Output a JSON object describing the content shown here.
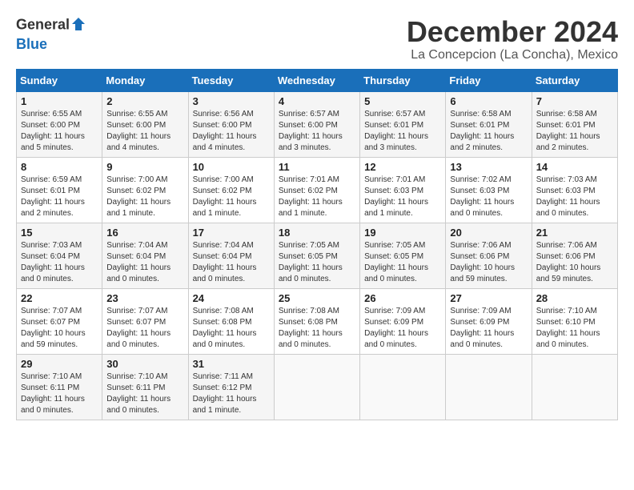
{
  "logo": {
    "general": "General",
    "blue": "Blue"
  },
  "header": {
    "month": "December 2024",
    "location": "La Concepcion (La Concha), Mexico"
  },
  "weekdays": [
    "Sunday",
    "Monday",
    "Tuesday",
    "Wednesday",
    "Thursday",
    "Friday",
    "Saturday"
  ],
  "weeks": [
    [
      {
        "day": "1",
        "info": "Sunrise: 6:55 AM\nSunset: 6:00 PM\nDaylight: 11 hours and 5 minutes."
      },
      {
        "day": "2",
        "info": "Sunrise: 6:55 AM\nSunset: 6:00 PM\nDaylight: 11 hours and 4 minutes."
      },
      {
        "day": "3",
        "info": "Sunrise: 6:56 AM\nSunset: 6:00 PM\nDaylight: 11 hours and 4 minutes."
      },
      {
        "day": "4",
        "info": "Sunrise: 6:57 AM\nSunset: 6:00 PM\nDaylight: 11 hours and 3 minutes."
      },
      {
        "day": "5",
        "info": "Sunrise: 6:57 AM\nSunset: 6:01 PM\nDaylight: 11 hours and 3 minutes."
      },
      {
        "day": "6",
        "info": "Sunrise: 6:58 AM\nSunset: 6:01 PM\nDaylight: 11 hours and 2 minutes."
      },
      {
        "day": "7",
        "info": "Sunrise: 6:58 AM\nSunset: 6:01 PM\nDaylight: 11 hours and 2 minutes."
      }
    ],
    [
      {
        "day": "8",
        "info": "Sunrise: 6:59 AM\nSunset: 6:01 PM\nDaylight: 11 hours and 2 minutes."
      },
      {
        "day": "9",
        "info": "Sunrise: 7:00 AM\nSunset: 6:02 PM\nDaylight: 11 hours and 1 minute."
      },
      {
        "day": "10",
        "info": "Sunrise: 7:00 AM\nSunset: 6:02 PM\nDaylight: 11 hours and 1 minute."
      },
      {
        "day": "11",
        "info": "Sunrise: 7:01 AM\nSunset: 6:02 PM\nDaylight: 11 hours and 1 minute."
      },
      {
        "day": "12",
        "info": "Sunrise: 7:01 AM\nSunset: 6:03 PM\nDaylight: 11 hours and 1 minute."
      },
      {
        "day": "13",
        "info": "Sunrise: 7:02 AM\nSunset: 6:03 PM\nDaylight: 11 hours and 0 minutes."
      },
      {
        "day": "14",
        "info": "Sunrise: 7:03 AM\nSunset: 6:03 PM\nDaylight: 11 hours and 0 minutes."
      }
    ],
    [
      {
        "day": "15",
        "info": "Sunrise: 7:03 AM\nSunset: 6:04 PM\nDaylight: 11 hours and 0 minutes."
      },
      {
        "day": "16",
        "info": "Sunrise: 7:04 AM\nSunset: 6:04 PM\nDaylight: 11 hours and 0 minutes."
      },
      {
        "day": "17",
        "info": "Sunrise: 7:04 AM\nSunset: 6:04 PM\nDaylight: 11 hours and 0 minutes."
      },
      {
        "day": "18",
        "info": "Sunrise: 7:05 AM\nSunset: 6:05 PM\nDaylight: 11 hours and 0 minutes."
      },
      {
        "day": "19",
        "info": "Sunrise: 7:05 AM\nSunset: 6:05 PM\nDaylight: 11 hours and 0 minutes."
      },
      {
        "day": "20",
        "info": "Sunrise: 7:06 AM\nSunset: 6:06 PM\nDaylight: 10 hours and 59 minutes."
      },
      {
        "day": "21",
        "info": "Sunrise: 7:06 AM\nSunset: 6:06 PM\nDaylight: 10 hours and 59 minutes."
      }
    ],
    [
      {
        "day": "22",
        "info": "Sunrise: 7:07 AM\nSunset: 6:07 PM\nDaylight: 10 hours and 59 minutes."
      },
      {
        "day": "23",
        "info": "Sunrise: 7:07 AM\nSunset: 6:07 PM\nDaylight: 11 hours and 0 minutes."
      },
      {
        "day": "24",
        "info": "Sunrise: 7:08 AM\nSunset: 6:08 PM\nDaylight: 11 hours and 0 minutes."
      },
      {
        "day": "25",
        "info": "Sunrise: 7:08 AM\nSunset: 6:08 PM\nDaylight: 11 hours and 0 minutes."
      },
      {
        "day": "26",
        "info": "Sunrise: 7:09 AM\nSunset: 6:09 PM\nDaylight: 11 hours and 0 minutes."
      },
      {
        "day": "27",
        "info": "Sunrise: 7:09 AM\nSunset: 6:09 PM\nDaylight: 11 hours and 0 minutes."
      },
      {
        "day": "28",
        "info": "Sunrise: 7:10 AM\nSunset: 6:10 PM\nDaylight: 11 hours and 0 minutes."
      }
    ],
    [
      {
        "day": "29",
        "info": "Sunrise: 7:10 AM\nSunset: 6:11 PM\nDaylight: 11 hours and 0 minutes."
      },
      {
        "day": "30",
        "info": "Sunrise: 7:10 AM\nSunset: 6:11 PM\nDaylight: 11 hours and 0 minutes."
      },
      {
        "day": "31",
        "info": "Sunrise: 7:11 AM\nSunset: 6:12 PM\nDaylight: 11 hours and 1 minute."
      },
      {
        "day": "",
        "info": ""
      },
      {
        "day": "",
        "info": ""
      },
      {
        "day": "",
        "info": ""
      },
      {
        "day": "",
        "info": ""
      }
    ]
  ]
}
